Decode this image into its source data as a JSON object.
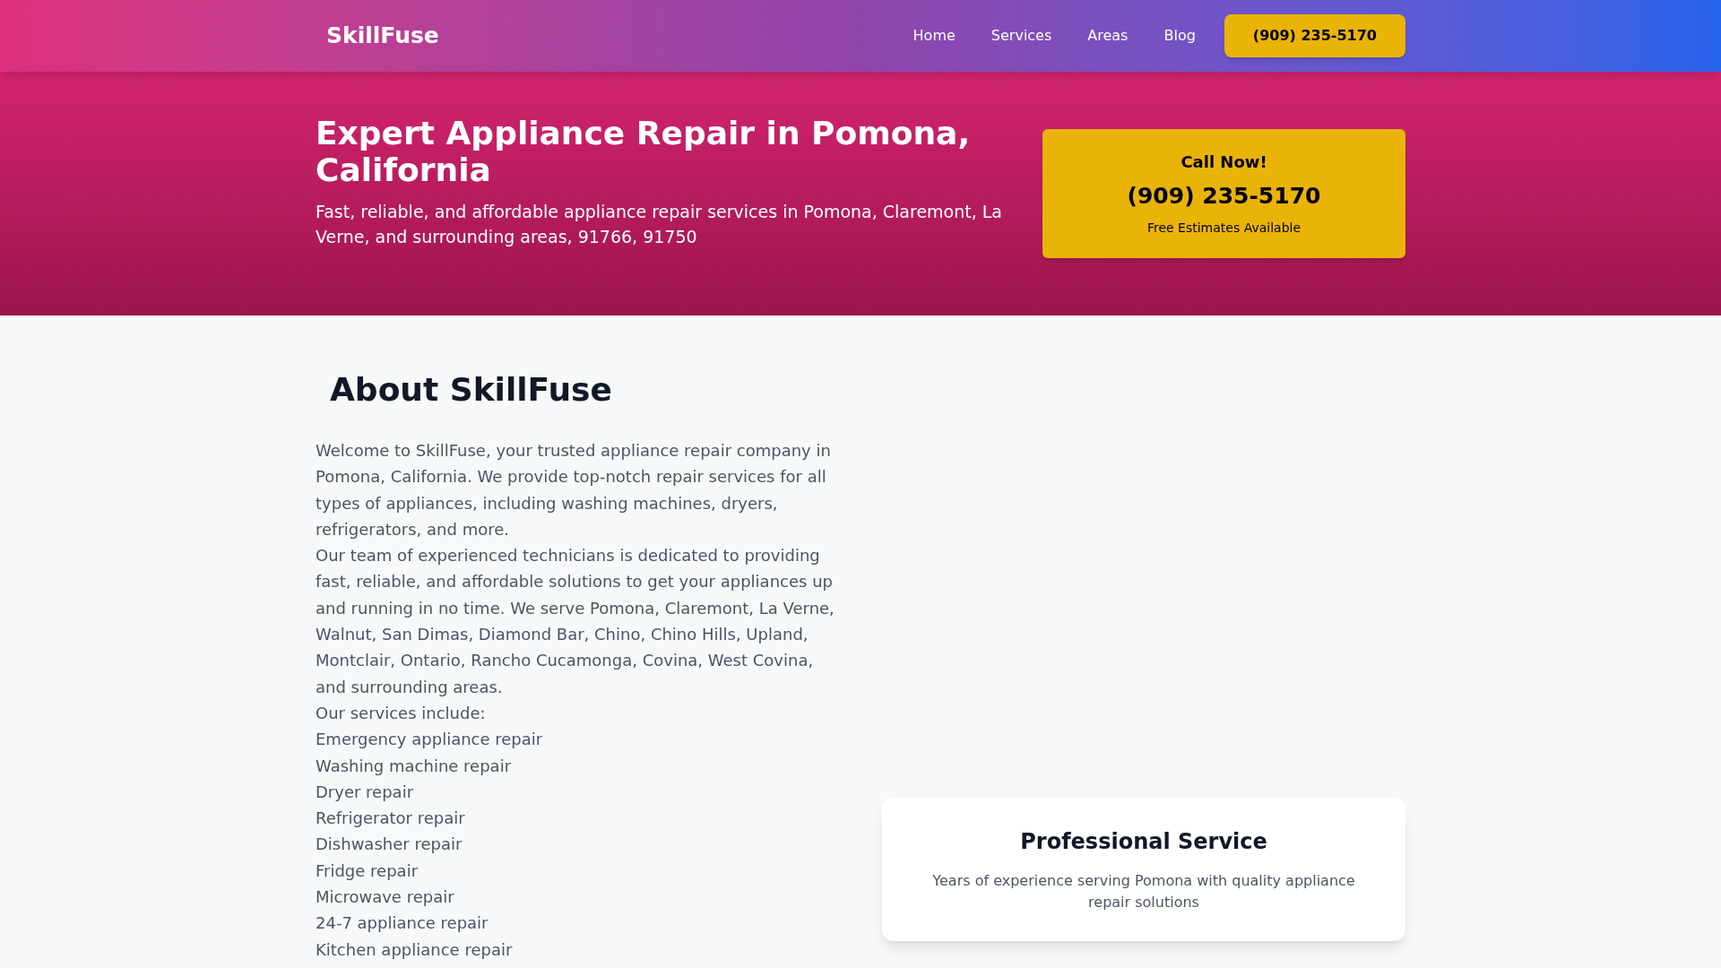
{
  "header": {
    "logo": "SkillFuse",
    "nav": [
      "Home",
      "Services",
      "Areas",
      "Blog"
    ],
    "phone_button": "(909) 235-5170"
  },
  "hero": {
    "title": "Expert Appliance Repair in Pomona, California",
    "subtitle": "Fast, reliable, and affordable appliance repair services in Pomona, Claremont, La Verne, and surrounding areas, 91766, 91750",
    "call_card": {
      "heading": "Call Now!",
      "phone": "(909) 235-5170",
      "note": "Free Estimates Available"
    }
  },
  "about": {
    "title": "About SkillFuse",
    "paragraphs": [
      "Welcome to SkillFuse, your trusted appliance repair company in Pomona, California. We provide top-notch repair services for all types of appliances, including washing machines, dryers, refrigerators, and more.",
      "Our team of experienced technicians is dedicated to providing fast, reliable, and affordable solutions to get your appliances up and running in no time. We serve Pomona, Claremont, La Verne, Walnut, San Dimas, Diamond Bar, Chino, Chino Hills, Upland, Montclair, Ontario, Rancho Cucamonga, Covina, West Covina, and surrounding areas.",
      "Our services include:"
    ],
    "services": [
      "Emergency appliance repair",
      "Washing machine repair",
      "Dryer repair",
      "Refrigerator repair",
      "Dishwasher repair",
      "Fridge repair",
      "Microwave repair",
      "24-7 appliance repair",
      "Kitchen appliance repair"
    ],
    "feature_card": {
      "title": "Professional Service",
      "text": "Years of experience serving Pomona with quality appliance repair solutions"
    }
  }
}
